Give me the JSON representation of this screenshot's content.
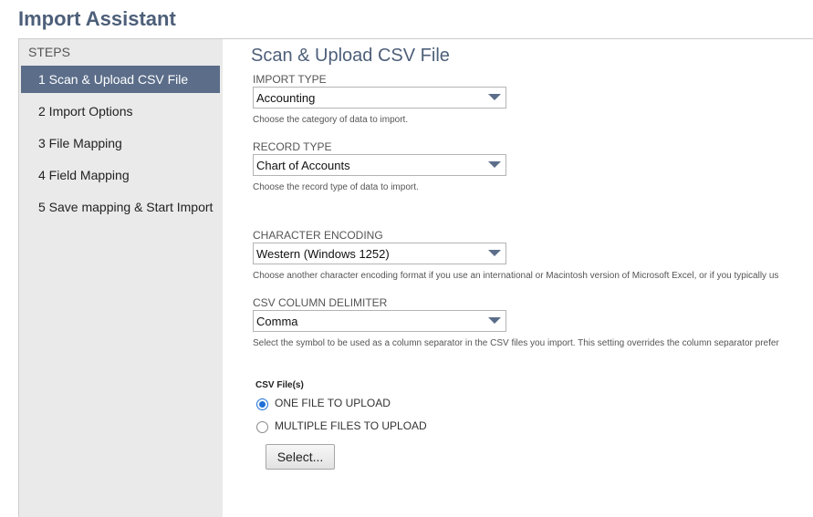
{
  "page": {
    "title": "Import Assistant"
  },
  "sidebar": {
    "heading": "STEPS",
    "items": [
      {
        "label": "1 Scan & Upload CSV File",
        "active": true
      },
      {
        "label": "2 Import Options",
        "active": false
      },
      {
        "label": "3 File Mapping",
        "active": false
      },
      {
        "label": "4 Field Mapping",
        "active": false
      },
      {
        "label": "5 Save mapping & Start Import",
        "active": false
      }
    ]
  },
  "main": {
    "title": "Scan & Upload CSV File",
    "import_type": {
      "label": "IMPORT TYPE",
      "value": "Accounting",
      "help": "Choose the category of data to import."
    },
    "record_type": {
      "label": "RECORD TYPE",
      "value": "Chart of Accounts",
      "help": "Choose the record type of data to import."
    },
    "character_encoding": {
      "label": "CHARACTER ENCODING",
      "value": "Western (Windows 1252)",
      "help": "Choose another character encoding format if you use an international or Macintosh version of Microsoft Excel, or if you typically us"
    },
    "csv_delimiter": {
      "label": "CSV COLUMN DELIMITER",
      "value": "Comma",
      "help": "Select the symbol to be used as a column separator in the CSV files you import. This setting overrides the column separator prefer"
    },
    "csv_files": {
      "label": "CSV File(s)",
      "options": [
        {
          "label": "ONE FILE TO UPLOAD",
          "selected": true
        },
        {
          "label": "MULTIPLE FILES TO UPLOAD",
          "selected": false
        }
      ],
      "select_button": "Select..."
    }
  },
  "colors": {
    "title": "#4d5f79",
    "active_step": "#5b6d89",
    "sidebar_bg": "#eaeaea",
    "radio_selected": "#1f6fd6"
  },
  "icons": {
    "dropdown": "triangle-down-icon",
    "radio_on": "radio-checked-icon",
    "radio_off": "radio-unchecked-icon"
  }
}
